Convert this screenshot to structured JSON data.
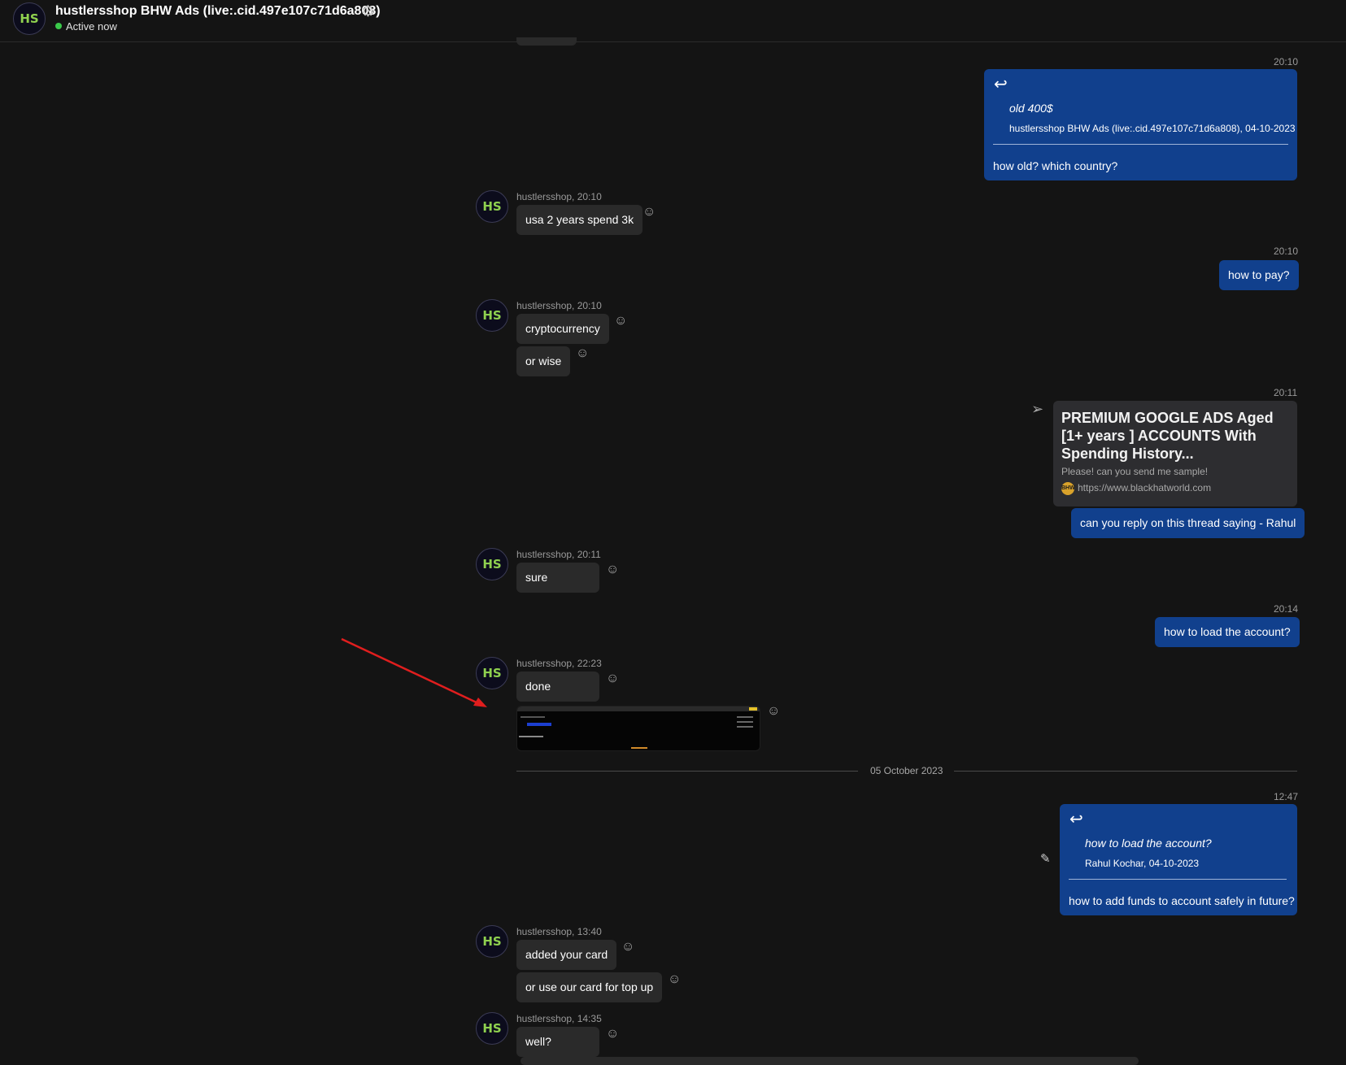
{
  "header": {
    "avatar_text": "HS",
    "title": "hustlersshop BHW Ads (live:.cid.497e107c71d6a808)",
    "status": "Active now",
    "status_color": "#3ac94a"
  },
  "icons": {
    "gear": "⚙",
    "reply": "↩",
    "emoji": "☺",
    "send": "➢",
    "pencil": "✎"
  },
  "colors": {
    "outgoing_bubble": "#11408d",
    "incoming_bubble": "#2a2a2a",
    "background": "#141414",
    "annotation_arrow": "#e01e1e"
  },
  "contact_avatar_text": "HS",
  "messages": {
    "m1": {
      "time": "20:10",
      "quote_text": "old 400$",
      "quote_source": "hustlersshop BHW Ads (live:.cid.497e107c71d6a808), 04-10-2023",
      "text": "how old? which country?"
    },
    "m2": {
      "meta": "hustlersshop, 20:10",
      "text": "usa 2 years spend 3k"
    },
    "m3": {
      "time": "20:10",
      "text": "how to pay?"
    },
    "m4": {
      "meta": "hustlersshop, 20:10",
      "text1": "cryptocurrency",
      "text2": "or wise"
    },
    "m5": {
      "time": "20:11",
      "card_title": "PREMIUM GOOGLE ADS Aged [1+ years ] ACCOUNTS With Spending History...",
      "card_desc": "Please!  can you send me sample!",
      "card_logo": "BHW",
      "card_url": "https://www.blackhatworld.com",
      "text": "can you reply on this thread saying - Rahul"
    },
    "m6": {
      "meta": "hustlersshop, 20:11",
      "text": "sure"
    },
    "m7": {
      "time": "20:14",
      "text": "how to load the account?"
    },
    "m8": {
      "meta": "hustlersshop, 22:23",
      "text": "done"
    },
    "date_divider": "05 October 2023",
    "m9": {
      "time": "12:47",
      "quote_text": "how to load the account?",
      "quote_source": "Rahul Kochar, 04-10-2023",
      "text": "how to add funds to account safely in future?"
    },
    "m10": {
      "meta": "hustlersshop, 13:40",
      "text1": "added your card",
      "text2": "or use our card for top up"
    },
    "m11": {
      "meta": "hustlersshop, 14:35",
      "text": "well?"
    }
  }
}
